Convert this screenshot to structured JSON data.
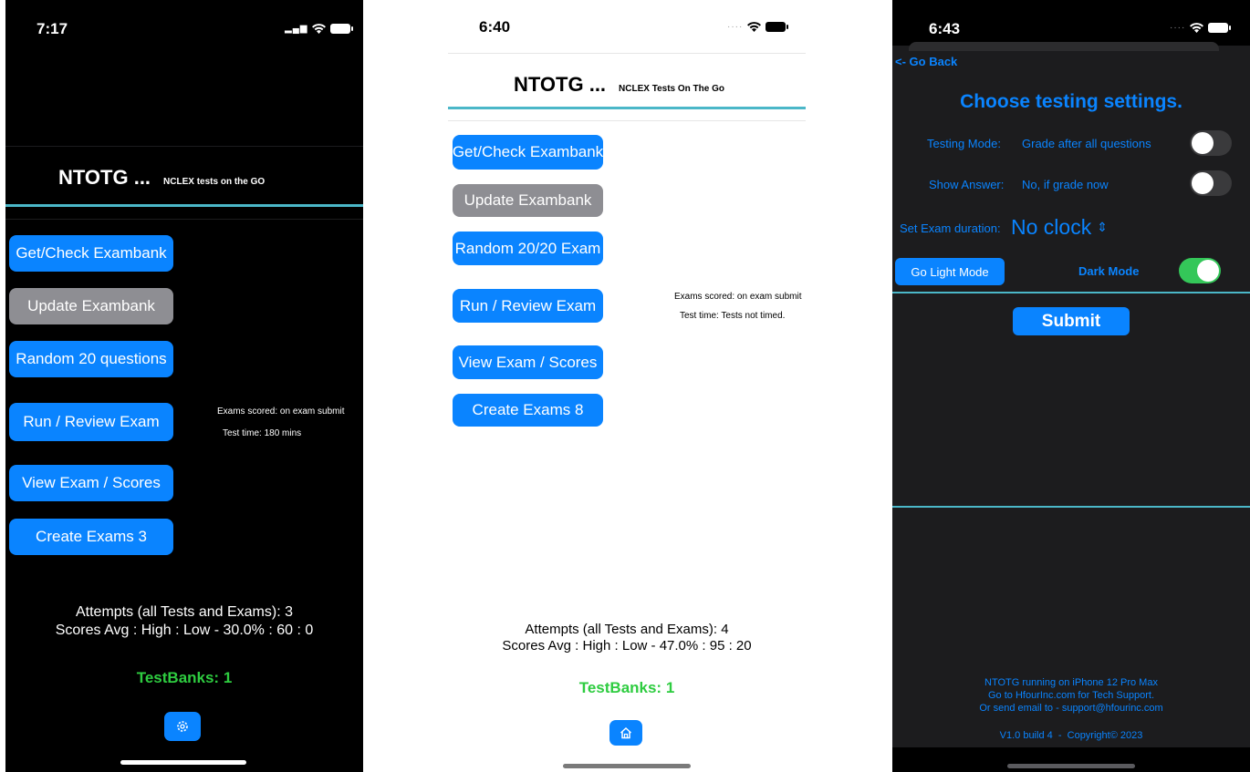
{
  "screen1": {
    "time": "7:17",
    "app_name": "NTOTG ...",
    "subtitle": "NCLEX tests on the GO",
    "buttons": {
      "get_check": "Get/Check Exambank",
      "update": "Update Exambank",
      "random": "Random 20 questions",
      "run_review": "Run / Review Exam",
      "view_scores": "View Exam / Scores",
      "create": "Create Exams 3"
    },
    "info": {
      "exams_scored": "Exams scored: on exam submit",
      "test_time": "Test time: 180 mins"
    },
    "attempts": "Attempts (all Tests and Exams): 3",
    "scores": "Scores Avg : High : Low - 30.0% : 60 : 0",
    "testbanks": "TestBanks: 1",
    "icons": {
      "bottom": "gear-icon"
    }
  },
  "screen2": {
    "time": "6:40",
    "app_name": "NTOTG ...",
    "subtitle": "NCLEX Tests On The Go",
    "buttons": {
      "get_check": "Get/Check Exambank",
      "update": "Update Exambank",
      "random": "Random 20/20 Exam",
      "run_review": "Run / Review Exam",
      "view_scores": "View Exam / Scores",
      "create": "Create Exams 8"
    },
    "info": {
      "exams_scored": "Exams scored: on exam submit",
      "test_time": "Test time: Tests not timed."
    },
    "attempts": "Attempts (all Tests and Exams): 4",
    "scores": "Scores Avg : High : Low - 47.0% : 95 : 20",
    "testbanks": "TestBanks: 1",
    "icons": {
      "bottom": "home-icon"
    }
  },
  "screen3": {
    "time": "6:43",
    "back": "<- Go Back",
    "title": "Choose testing settings.",
    "testing_mode_label": "Testing Mode:",
    "testing_mode_value": "Grade after all questions",
    "show_answer_label": "Show Answer:",
    "show_answer_value": "No, if grade now",
    "duration_label": "Set Exam duration:",
    "duration_value": "No clock",
    "go_light": "Go Light Mode",
    "dark_mode": "Dark Mode",
    "submit": "Submit",
    "toggles": {
      "testing_mode": false,
      "show_answer": false,
      "dark_mode": true
    },
    "footer": {
      "line1": "NTOTG running on iPhone 12 Pro Max",
      "line2": "Go to HfourInc.com for Tech Support.",
      "line3": "Or send email to - support@hfourinc.com",
      "version": "V1.0 build 4  -  Copyright© 2023"
    }
  },
  "colors": {
    "accent": "#0a84ff",
    "divider": "#4bb7c8",
    "green": "#2ecc40",
    "grey_button": "#8e8e93"
  }
}
